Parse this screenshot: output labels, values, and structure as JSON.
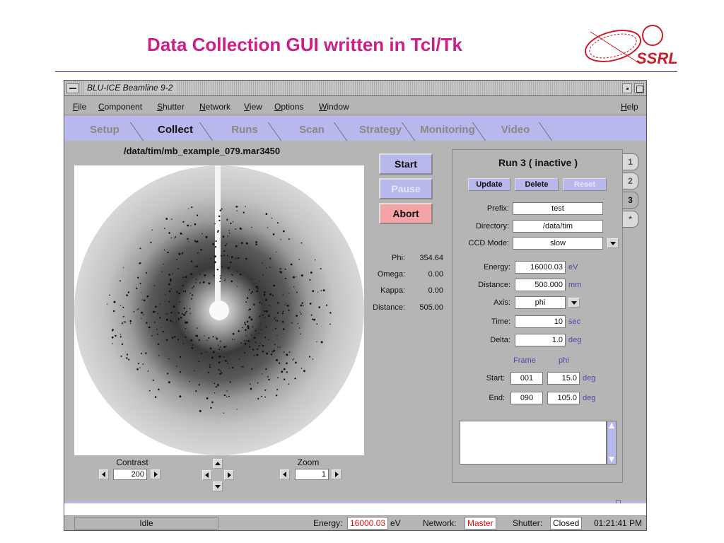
{
  "slide": {
    "title": "Data Collection GUI written in Tcl/Tk",
    "logo_text": "SSRL"
  },
  "window": {
    "title": "BLU-ICE   Beamline 9-2"
  },
  "menu": {
    "items": [
      {
        "first": "F",
        "rest": "ile"
      },
      {
        "first": "C",
        "rest": "omponent"
      },
      {
        "first": "S",
        "rest": "hutter"
      },
      {
        "first": "N",
        "rest": "etwork"
      },
      {
        "first": "V",
        "rest": "iew"
      },
      {
        "first": "O",
        "rest": "ptions"
      },
      {
        "first": "W",
        "rest": "indow"
      }
    ],
    "help": {
      "first": "H",
      "rest": "elp"
    }
  },
  "tabs": [
    "Setup",
    "Collect",
    "Runs",
    "Scan",
    "Strategy",
    "Monitoring",
    "Video"
  ],
  "active_tab": "Collect",
  "image": {
    "path": "/data/tim/mb_example_079.mar3450"
  },
  "buttons": {
    "start": "Start",
    "pause": "Pause",
    "abort": "Abort"
  },
  "motors": [
    {
      "label": "Phi:",
      "value": "354.64"
    },
    {
      "label": "Omega:",
      "value": "0.00"
    },
    {
      "label": "Kappa:",
      "value": "0.00"
    },
    {
      "label": "Distance:",
      "value": "505.00"
    }
  ],
  "run": {
    "title": "Run 3   ( inactive )",
    "update": "Update",
    "delete": "Delete",
    "reset": "Reset",
    "prefix_label": "Prefix:",
    "prefix": "test",
    "directory_label": "Directory:",
    "directory": "/data/tim",
    "ccd_label": "CCD Mode:",
    "ccd_mode": "slow",
    "energy_label": "Energy:",
    "energy": "16000.03",
    "energy_unit": "eV",
    "distance_label": "Distance:",
    "distance": "500.000",
    "distance_unit": "mm",
    "axis_label": "Axis:",
    "axis": "phi",
    "time_label": "Time:",
    "time": "10",
    "time_unit": "sec",
    "delta_label": "Delta:",
    "delta": "1.0",
    "delta_unit": "deg",
    "col_frame": "Frame",
    "col_phi": "phi",
    "start_label": "Start:",
    "start_frame": "001",
    "start_phi": "15.0",
    "start_unit": "deg",
    "end_label": "End:",
    "end_frame": "090",
    "end_phi": "105.0",
    "end_unit": "deg"
  },
  "run_tabs": [
    "1",
    "2",
    "3",
    "*"
  ],
  "active_run_tab": "3",
  "controls": {
    "contrast_label": "Contrast",
    "contrast_value": "200",
    "zoom_label": "Zoom",
    "zoom_value": "1"
  },
  "status": {
    "state": "Idle",
    "energy_label": "Energy:",
    "energy_value": "16000.03",
    "energy_unit": "eV",
    "network_label": "Network:",
    "network_value": "Master",
    "shutter_label": "Shutter:",
    "shutter_value": "Closed",
    "time": "01:21:41 PM"
  },
  "colors": {
    "title_magenta": "#cc1d8a",
    "tab_blue": "#b8b8ec",
    "abort_red": "#f4a4a4",
    "status_red": "#dd1111",
    "unit_blue": "#4a4aaa"
  }
}
